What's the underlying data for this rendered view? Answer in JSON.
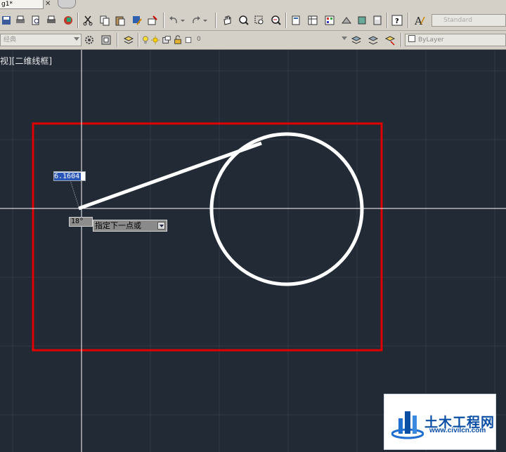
{
  "file_tab": {
    "label": "g1*"
  },
  "toolbar": {
    "style_combo": "Standard",
    "workspace_combo": "经典",
    "layer_combo": "0",
    "color_combo": "ByLayer"
  },
  "viewport": {
    "label": "视][二维线框]"
  },
  "dynamic_input": {
    "distance": "6.1604",
    "angle": "18°",
    "prompt": "指定下一点或"
  },
  "watermark": {
    "title": "土木工程网",
    "url": "www.civilcn.com"
  },
  "colors": {
    "canvas_bg": "#222a35",
    "grid_major": "#313b48",
    "crosshair": "#ffffff",
    "geometry": "#ffffff",
    "highlight_rect": "#e00000",
    "toolbar_bg": "#d4d0c8"
  },
  "icons": [
    "save-icon",
    "print-icon",
    "print-preview-icon",
    "publish-icon",
    "3d-icon",
    "cut-icon",
    "copy-icon",
    "paste-icon",
    "match-properties-icon",
    "block-editor-icon",
    "undo-icon",
    "redo-icon",
    "pan-icon",
    "zoom-realtime-icon",
    "zoom-window-icon",
    "zoom-previous-icon",
    "properties-icon",
    "design-center-icon",
    "tool-palettes-icon",
    "sheet-set-icon",
    "markup-icon",
    "calculator-icon",
    "help-icon",
    "text-style-icon",
    "gear-icon",
    "workspace-icon",
    "layer-manager-icon",
    "lightbulb-icon",
    "sun-icon",
    "freeze-icon",
    "lock-icon",
    "layer-color-icon",
    "make-current-icon",
    "layer-previous-icon",
    "layer-state-icon"
  ]
}
